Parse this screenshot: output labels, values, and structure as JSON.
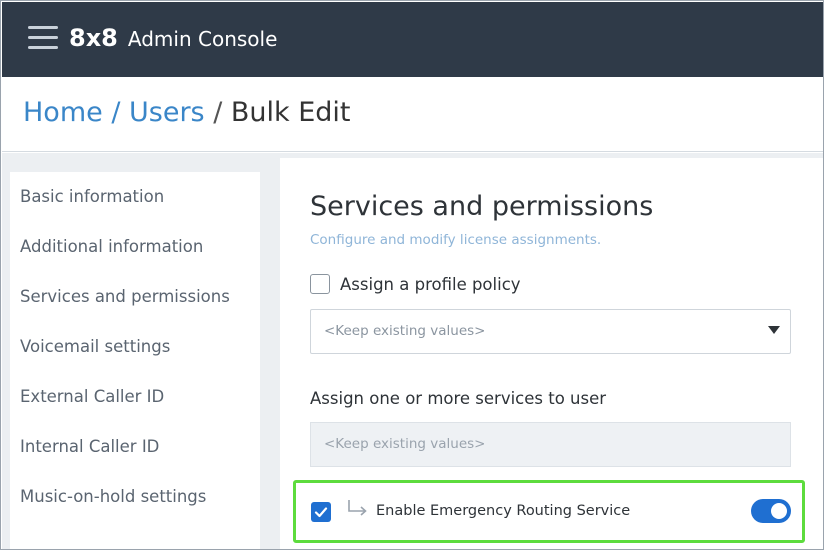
{
  "header": {
    "logo_text": "8x8",
    "app_title": "Admin Console"
  },
  "breadcrumb": {
    "home": "Home",
    "sep1": " / ",
    "users": "Users",
    "sep2": " / ",
    "current": "Bulk Edit"
  },
  "sidebar": {
    "items": [
      {
        "label": "Basic information"
      },
      {
        "label": "Additional information"
      },
      {
        "label": "Services and permissions"
      },
      {
        "label": "Voicemail settings"
      },
      {
        "label": "External Caller ID"
      },
      {
        "label": "Internal Caller ID"
      },
      {
        "label": "Music-on-hold settings"
      }
    ]
  },
  "main": {
    "title": "Services and permissions",
    "subtitle": "Configure and modify license assignments.",
    "profile_policy": {
      "label": "Assign a profile policy",
      "checked": false,
      "select_value": "<Keep existing values>"
    },
    "services": {
      "label": "Assign one or more services to user",
      "value": "<Keep existing values>"
    },
    "emergency_routing": {
      "label": "Enable Emergency Routing Service",
      "checked": true,
      "toggle_on": true
    }
  },
  "colors": {
    "topbar": "#2f3a48",
    "link": "#3a86c8",
    "accent": "#1f6fd1",
    "highlight": "#5ddc3d"
  }
}
